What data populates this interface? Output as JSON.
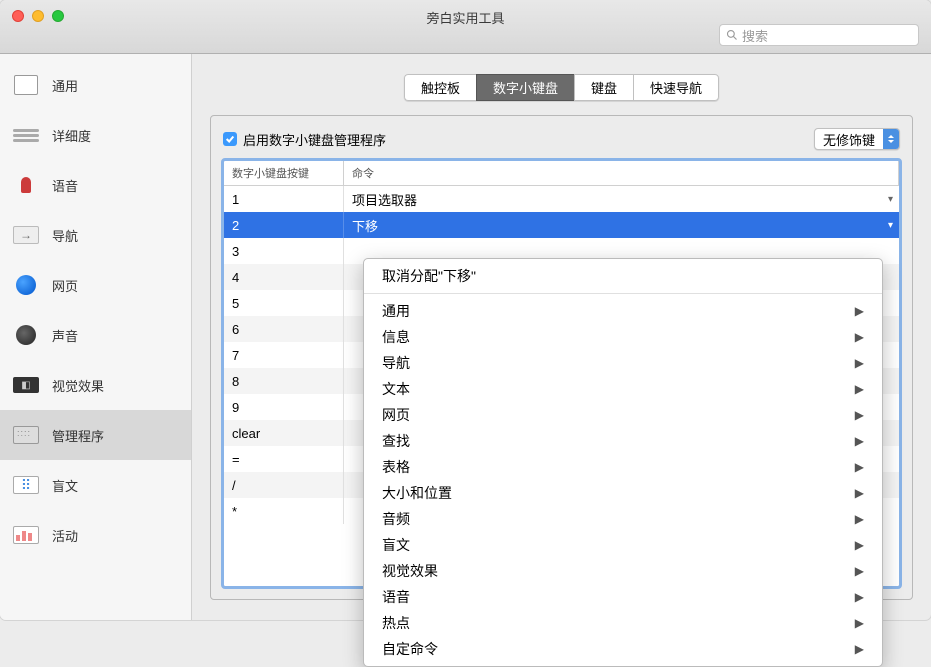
{
  "window": {
    "title": "旁白实用工具"
  },
  "search": {
    "placeholder": "搜索"
  },
  "sidebar": {
    "items": [
      {
        "label": "通用"
      },
      {
        "label": "详细度"
      },
      {
        "label": "语音"
      },
      {
        "label": "导航"
      },
      {
        "label": "网页"
      },
      {
        "label": "声音"
      },
      {
        "label": "视觉效果"
      },
      {
        "label": "管理程序"
      },
      {
        "label": "盲文"
      },
      {
        "label": "活动"
      }
    ],
    "selected_index": 7
  },
  "tabs": {
    "items": [
      "触控板",
      "数字小键盘",
      "键盘",
      "快速导航"
    ],
    "active_index": 1
  },
  "panel": {
    "checkbox_label": "启用数字小键盘管理程序",
    "checkbox_checked": true,
    "modifier_select": "无修饰键",
    "columns": {
      "key": "数字小键盘按键",
      "cmd": "命令"
    },
    "rows": [
      {
        "key": "1",
        "cmd": "项目选取器"
      },
      {
        "key": "2",
        "cmd": "下移"
      },
      {
        "key": "3",
        "cmd": ""
      },
      {
        "key": "4",
        "cmd": ""
      },
      {
        "key": "5",
        "cmd": ""
      },
      {
        "key": "6",
        "cmd": ""
      },
      {
        "key": "7",
        "cmd": ""
      },
      {
        "key": "8",
        "cmd": ""
      },
      {
        "key": "9",
        "cmd": ""
      },
      {
        "key": "clear",
        "cmd": ""
      },
      {
        "key": "=",
        "cmd": ""
      },
      {
        "key": "/",
        "cmd": ""
      },
      {
        "key": "*",
        "cmd": ""
      }
    ],
    "selected_row": 1
  },
  "popup": {
    "unassign": "取消分配\"下移\"",
    "items": [
      "通用",
      "信息",
      "导航",
      "文本",
      "网页",
      "查找",
      "表格",
      "大小和位置",
      "音频",
      "盲文",
      "视觉效果",
      "语音",
      "热点",
      "自定命令"
    ]
  }
}
